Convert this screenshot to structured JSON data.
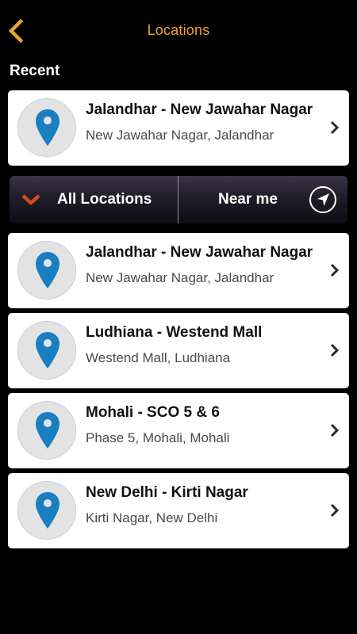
{
  "header": {
    "title": "Locations"
  },
  "recent": {
    "heading": "Recent",
    "item": {
      "title": "Jalandhar - New Jawahar Nagar",
      "subtitle": "New Jawahar Nagar, Jalandhar"
    }
  },
  "filter": {
    "all_label": "All Locations",
    "near_label": "Near me"
  },
  "locations": [
    {
      "title": "Jalandhar - New Jawahar Nagar",
      "subtitle": "New Jawahar Nagar, Jalandhar"
    },
    {
      "title": "Ludhiana - Westend Mall",
      "subtitle": "Westend Mall, Ludhiana"
    },
    {
      "title": "Mohali - SCO 5 & 6",
      "subtitle": "Phase 5, Mohali, Mohali"
    },
    {
      "title": "New Delhi - Kirti Nagar",
      "subtitle": "Kirti Nagar, New Delhi"
    }
  ],
  "icons": {
    "back": "chevron-left-icon",
    "pin": "map-pin-icon",
    "row_arrow": "chevron-right-icon",
    "dropdown": "chevron-down-icon",
    "near": "navigation-arrow-icon"
  },
  "colors": {
    "background": "#000000",
    "accent": "#f2a22c",
    "pin": "#1a7fc1",
    "dropdown": "#d9481c",
    "card": "#ffffff"
  }
}
